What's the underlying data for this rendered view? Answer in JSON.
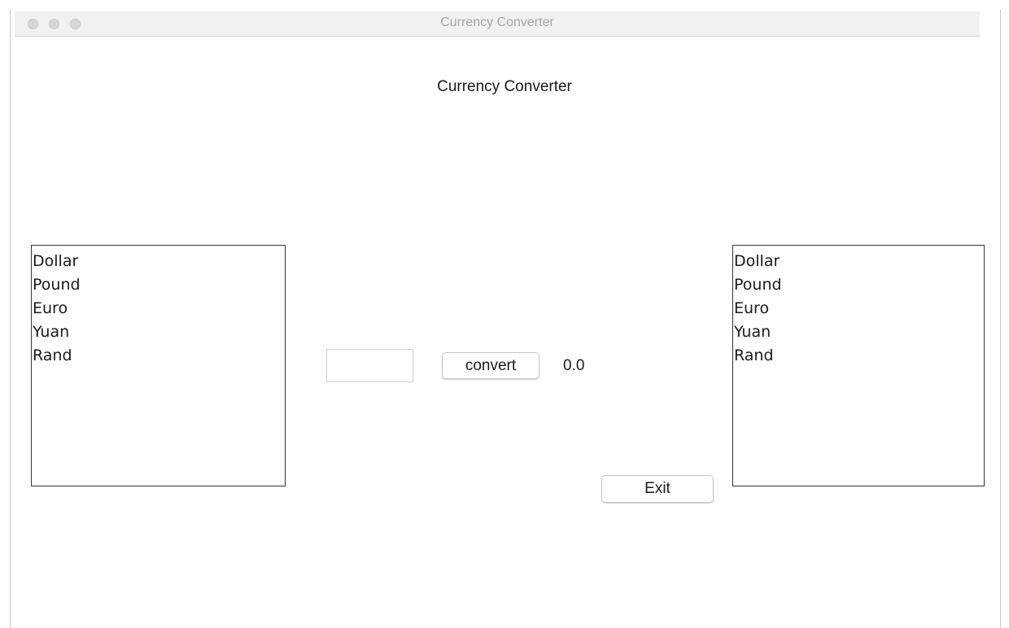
{
  "window": {
    "title": "Currency Converter"
  },
  "heading": "Currency Converter",
  "from_list": {
    "items": [
      "Dollar",
      "Pound",
      "Euro",
      "Yuan",
      "Rand"
    ]
  },
  "to_list": {
    "items": [
      "Dollar",
      "Pound",
      "Euro",
      "Yuan",
      "Rand"
    ]
  },
  "amount_input": {
    "value": ""
  },
  "convert_button": {
    "label": "convert"
  },
  "result": {
    "value": "0.0"
  },
  "exit_button": {
    "label": "Exit"
  }
}
